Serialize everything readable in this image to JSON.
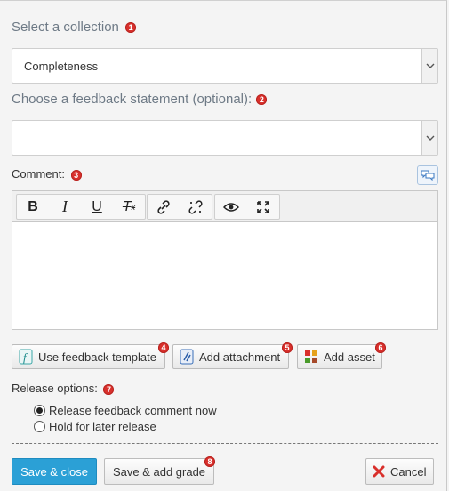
{
  "collection": {
    "label": "Select a collection",
    "badge": "1",
    "value": "Completeness"
  },
  "feedback_statement": {
    "label": "Choose a feedback statement (optional):",
    "badge": "2",
    "value": ""
  },
  "comment": {
    "label": "Comment:",
    "badge": "3"
  },
  "toolbar": {
    "bold": "B",
    "italic": "I",
    "underline": "U",
    "clear_format": "T"
  },
  "actions": {
    "feedback_template": {
      "label": "Use feedback template",
      "badge": "4"
    },
    "attachment": {
      "label": "Add attachment",
      "badge": "5"
    },
    "asset": {
      "label": "Add asset",
      "badge": "6"
    }
  },
  "release": {
    "label": "Release options:",
    "badge": "7",
    "options": [
      "Release feedback comment now",
      "Hold for later release"
    ],
    "selected": "Release feedback comment now"
  },
  "footer": {
    "save_close": "Save & close",
    "save_add_grade": "Save & add grade",
    "save_add_grade_badge": "8",
    "cancel": "Cancel"
  },
  "colors": {
    "primary": "#2ba0d6",
    "badge": "#d9302c",
    "cancel_icon": "#d9302c"
  }
}
